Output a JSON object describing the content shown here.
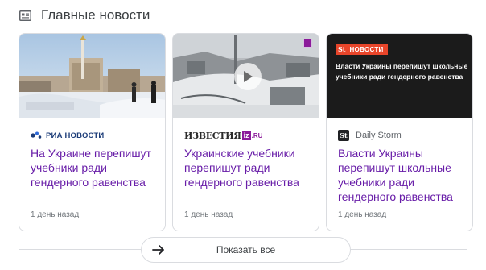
{
  "header": {
    "title": "Главные новости",
    "icon": "newspaper-icon"
  },
  "cards": [
    {
      "source": "РИА НОВОСТИ",
      "headline": "На Украине перепишут учебники ради гендерного равенства",
      "time": "1 день назад",
      "thumbnail": "snowy-city-square-photo"
    },
    {
      "source_main": "ИЗВЕСТИЯ",
      "source_box": "iz",
      "source_suffix": ".RU",
      "headline": "Украинские учебники перепишут ради гендерного равенства",
      "time": "1 день назад",
      "thumbnail": "winter-aerial-city-video",
      "play_icon": "play-icon"
    },
    {
      "source_logo": "St",
      "source": "Daily Storm",
      "headline": "Власти Украины перепишут школьные учебники ради гендерного равенства",
      "time": "1 день назад",
      "thumbnail_badge_st": "St",
      "thumbnail_badge_label": "НОВОСТИ",
      "thumbnail_text": "Власти Украины перепишут школьные учебники ради гендерного равенства"
    }
  ],
  "show_all": {
    "label": "Показать все",
    "icon": "arrow-right-icon"
  },
  "colors": {
    "headline": "#681da8",
    "meta": "#70757a",
    "border": "#dadce0",
    "daily_storm_accent": "#e8452a",
    "izvestia_accent": "#8b1a9a"
  }
}
